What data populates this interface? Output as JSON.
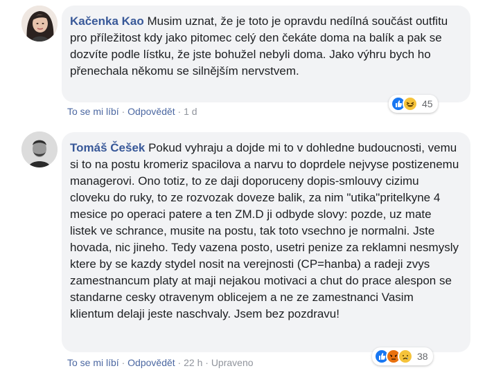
{
  "comments": [
    {
      "author": "Kačenka Kao",
      "text": "Musim uznat, že je toto je opravdu nedílná součást outfitu pro příležitost kdy jako pitomec celý den čekáte doma na balík a pak se dozvíte podle lístku, že jste bohužel nebyli doma. Jako výhru bych ho přenechala někomu se silnějším nervstvem.",
      "like_label": "To se mi líbí",
      "reply_label": "Odpovědět",
      "time": "1 d",
      "reaction_count": "45",
      "reactions": [
        "like-icon",
        "haha-icon"
      ]
    },
    {
      "author": "Tomáš Češek",
      "text": "Pokud vyhraju a dojde mi to v dohledne budoucnosti, vemu si to na postu kromeriz spacilova a narvu to doprdele nejvyse postizenemu managerovi. Ono totiz, to ze daji doporuceny dopis-smlouvy cizimu cloveku do ruky, to ze rozvozak doveze balik, za nim \"utika\"pritelkyne 4 mesice po operaci patere a ten ZM.D ji odbyde slovy: pozde, uz mate listek ve schrance, musite na postu, tak toto vsechno je normalni. Jste hovada, nic jineho. Tedy vazena posto, usetri penize za reklamni nesmysly ktere by se kazdy stydel nosit na verejnosti (CP=hanba) a radeji zvys zamestnancum platy at maji nejakou motivaci a chut do prace alespon se standarne cesky otravenym oblicejem a ne ze zamestnanci Vasim klientum delaji jeste naschvaly. Jsem bez pozdravu!",
      "like_label": "To se mi líbí",
      "reply_label": "Odpovědět",
      "time": "22 h",
      "edited": "Upraveno",
      "reaction_count": "38",
      "reactions": [
        "like-icon",
        "angry-icon",
        "sad-icon"
      ]
    }
  ],
  "colors": {
    "author": "#385898",
    "link": "#4b67a1",
    "bubble": "#f2f3f5",
    "like": "#1877f2"
  }
}
